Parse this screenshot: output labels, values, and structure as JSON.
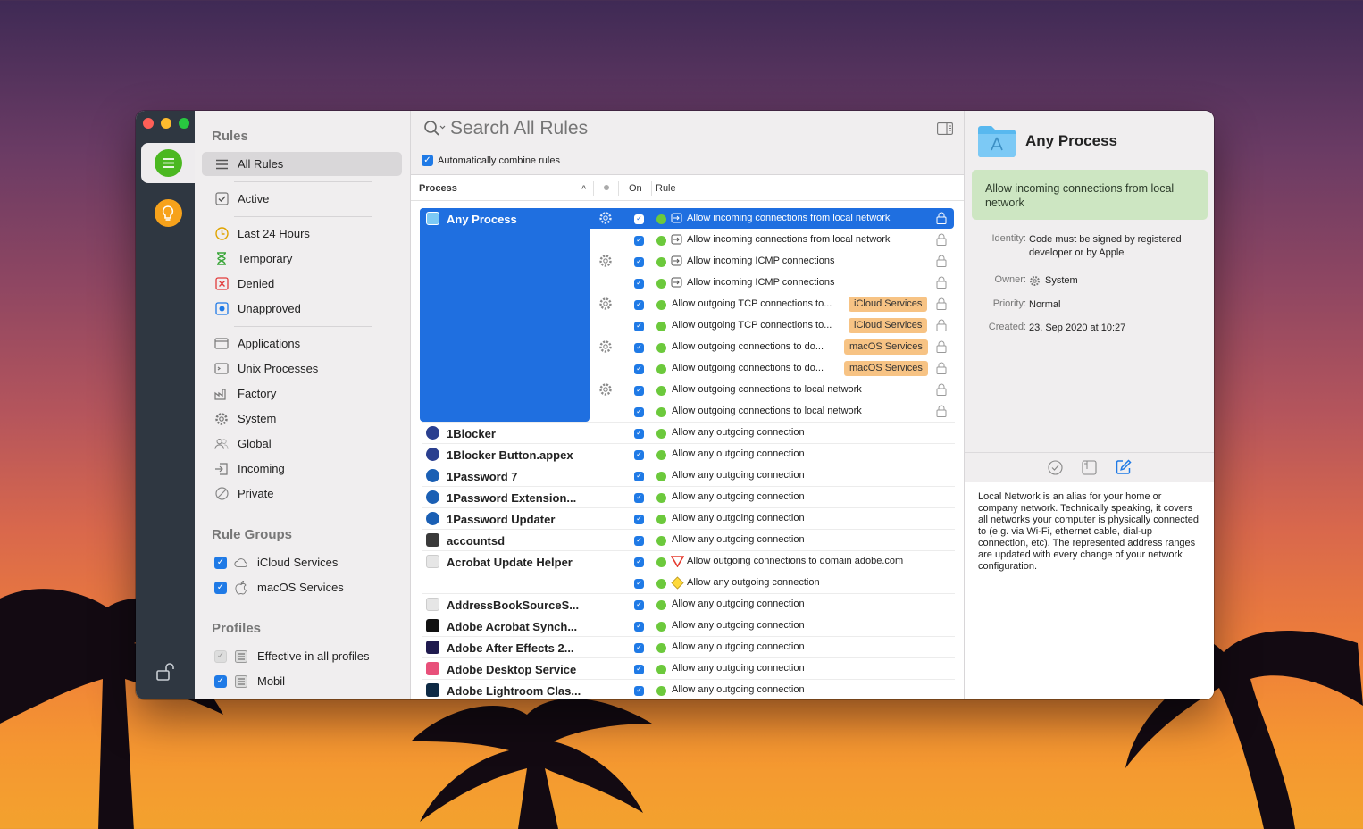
{
  "window": {
    "traffic_lights": [
      "#fe5f57",
      "#febc2e",
      "#28c840"
    ]
  },
  "rail": {
    "items": [
      {
        "name": "rules",
        "icon": "list-icon",
        "color": "#4bb821"
      },
      {
        "name": "suggestions",
        "icon": "lightbulb-icon",
        "color": "#f7a21b"
      }
    ],
    "lock_icon": "unlock-icon"
  },
  "sidebar": {
    "rules_header": "Rules",
    "rules": [
      {
        "label": "All Rules",
        "icon": "list-icon"
      },
      {
        "label": "Active",
        "icon": "checkbox-icon"
      },
      {
        "label": "Last 24 Hours",
        "icon": "clock-icon"
      },
      {
        "label": "Temporary",
        "icon": "hourglass-icon"
      },
      {
        "label": "Denied",
        "icon": "x-box-icon"
      },
      {
        "label": "Unapproved",
        "icon": "dot-box-icon"
      },
      {
        "label": "Applications",
        "icon": "window-icon"
      },
      {
        "label": "Unix Processes",
        "icon": "terminal-icon"
      },
      {
        "label": "Factory",
        "icon": "factory-icon"
      },
      {
        "label": "System",
        "icon": "gear-icon"
      },
      {
        "label": "Global",
        "icon": "people-icon"
      },
      {
        "label": "Incoming",
        "icon": "incoming-icon"
      },
      {
        "label": "Private",
        "icon": "slash-circle-icon"
      }
    ],
    "groups_header": "Rule Groups",
    "groups": [
      {
        "label": "iCloud Services",
        "icon": "cloud-icon",
        "checked": true
      },
      {
        "label": "macOS Services",
        "icon": "apple-icon",
        "checked": true
      }
    ],
    "profiles_header": "Profiles",
    "profiles": [
      {
        "label": "Effective in all profiles",
        "icon": "list-icon",
        "checked": false
      },
      {
        "label": "Mobil",
        "icon": "list-icon",
        "checked": true
      }
    ]
  },
  "search": {
    "placeholder": "Search All Rules",
    "combine_label": "Automatically combine rules"
  },
  "columns": {
    "process": "Process",
    "on": "On",
    "rule": "Rule"
  },
  "tags": {
    "icloud": "iCloud Services",
    "macos": "macOS Services"
  },
  "rows": [
    {
      "process": "Any Process",
      "rule": "Allow incoming connections from local network",
      "incoming": true,
      "gear": true,
      "lock": true,
      "selected": true
    },
    {
      "process": "",
      "rule": "Allow incoming connections from local network",
      "incoming": true,
      "lock": true
    },
    {
      "process": "",
      "rule": "Allow incoming ICMP connections",
      "incoming": true,
      "gear": true,
      "lock": true
    },
    {
      "process": "",
      "rule": "Allow incoming ICMP connections",
      "incoming": true,
      "lock": true
    },
    {
      "process": "",
      "rule": "Allow outgoing TCP connections to...",
      "tag": "icloud",
      "gear": true,
      "lock": true
    },
    {
      "process": "",
      "rule": "Allow outgoing TCP connections to...",
      "tag": "icloud",
      "lock": true
    },
    {
      "process": "",
      "rule": "Allow outgoing connections to do...",
      "tag": "macos",
      "gear": true,
      "lock": true
    },
    {
      "process": "",
      "rule": "Allow outgoing connections to do...",
      "tag": "macos",
      "lock": true
    },
    {
      "process": "",
      "rule": "Allow outgoing connections to local network",
      "gear": true,
      "lock": true
    },
    {
      "process": "",
      "rule": "Allow outgoing connections to local network",
      "lock": true,
      "line": true
    },
    {
      "process": "1Blocker",
      "rule": "Allow any outgoing connection",
      "icon": "#2a3f8f",
      "line": true
    },
    {
      "process": "1Blocker Button.appex",
      "rule": "Allow any outgoing connection",
      "icon": "#2a3f8f",
      "line": true
    },
    {
      "process": "1Password 7",
      "rule": "Allow any outgoing connection",
      "icon": "#1a5fb4",
      "line": true
    },
    {
      "process": "1Password Extension...",
      "rule": "Allow any outgoing connection",
      "icon": "#1a5fb4",
      "line": true
    },
    {
      "process": "1Password Updater",
      "rule": "Allow any outgoing connection",
      "icon": "#1a5fb4",
      "line": true
    },
    {
      "process": "accountsd",
      "rule": "Allow any outgoing connection",
      "icon": "#3a3a3a",
      "line": true
    },
    {
      "process": "Acrobat Update Helper",
      "rule": "Allow outgoing connections to domain adobe.com",
      "icon": "#e6e6e6",
      "special": "deny"
    },
    {
      "process": "",
      "rule": "Allow any outgoing connection",
      "special": "warn",
      "line": true
    },
    {
      "process": "AddressBookSourceS...",
      "rule": "Allow any outgoing connection",
      "icon": "#e6e6e6",
      "line": true
    },
    {
      "process": "Adobe Acrobat Synch...",
      "rule": "Allow any outgoing connection",
      "icon": "#111111",
      "line": true
    },
    {
      "process": "Adobe After Effects 2...",
      "rule": "Allow any outgoing connection",
      "icon": "#1f1a4e",
      "line": true
    },
    {
      "process": "Adobe Desktop Service",
      "rule": "Allow any outgoing connection",
      "icon": "#e8507a",
      "line": true
    },
    {
      "process": "Adobe Lightroom Clas...",
      "rule": "Allow any outgoing connection",
      "icon": "#0e2a45",
      "line": true
    }
  ],
  "detail": {
    "title": "Any Process",
    "summary": "Allow incoming connections from local network",
    "identity_label": "Identity:",
    "identity_value": "Code must be signed by registered developer or by Apple",
    "owner_label": "Owner:",
    "owner_value": "System",
    "priority_label": "Priority:",
    "priority_value": "Normal",
    "created_label": "Created:",
    "created_value": "23. Sep 2020 at 10:27",
    "note": "Local Network is an alias for your home or company network. Technically speaking, it covers all networks your computer is physically connected to (e.g. via Wi-Fi, ethernet cable, dial-up connection, etc). The represented address ranges are updated with every change of your network configuration."
  }
}
